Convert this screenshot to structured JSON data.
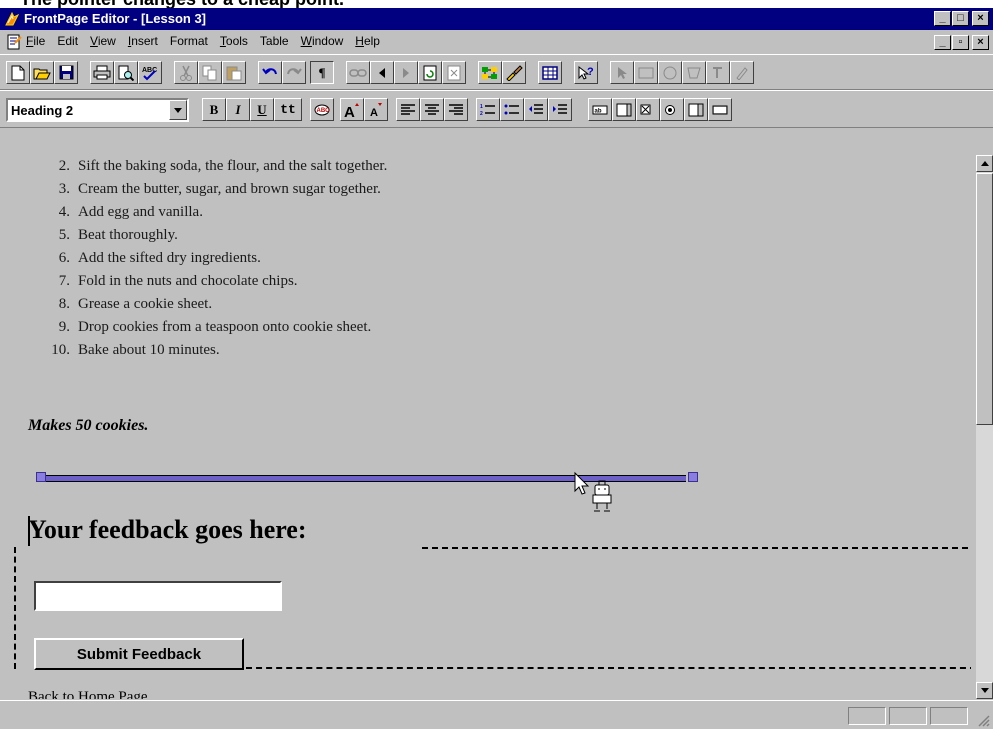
{
  "caption": "The pointer changes to a cheap point.",
  "window": {
    "title": "FrontPage Editor - [Lesson 3]",
    "controls": {
      "minimize": "_",
      "maximize": "□",
      "close": "×",
      "restore": "▫"
    }
  },
  "menu": {
    "items": [
      {
        "first": "F",
        "rest": "ile"
      },
      {
        "first": "",
        "rest": "Edit"
      },
      {
        "first": "V",
        "rest": "iew"
      },
      {
        "first": "I",
        "rest": "nsert"
      },
      {
        "first": "",
        "rest": "Format"
      },
      {
        "first": "T",
        "rest": "ools"
      },
      {
        "first": "",
        "rest": "Table"
      },
      {
        "first": "W",
        "rest": "indow"
      },
      {
        "first": "H",
        "rest": "elp"
      }
    ]
  },
  "format_toolbar": {
    "style_value": "Heading 2",
    "bold": "B",
    "italic": "I",
    "underline": "U",
    "typewriter": "tt"
  },
  "document": {
    "steps": [
      {
        "n": "2.",
        "text": "Sift the baking soda, the flour, and the salt together."
      },
      {
        "n": "3.",
        "text": "Cream the butter, sugar, and brown sugar together."
      },
      {
        "n": "4.",
        "text": "Add egg and vanilla."
      },
      {
        "n": "5.",
        "text": "Beat thoroughly."
      },
      {
        "n": "6.",
        "text": "Add the sifted dry ingredients."
      },
      {
        "n": "7.",
        "text": "Fold in the nuts and chocolate chips."
      },
      {
        "n": "8.",
        "text": "Grease a cookie sheet."
      },
      {
        "n": "9.",
        "text": "Drop cookies from a teaspoon onto cookie sheet."
      },
      {
        "n": "10.",
        "text": "Bake about 10 minutes."
      }
    ],
    "makes": "Makes 50 cookies.",
    "feedback_heading": "Your feedback goes here:",
    "feedback_input_value": "",
    "submit_label": "Submit Feedback",
    "back_link": "Back to Home Page"
  },
  "colors": {
    "titlebar": "#000080",
    "window_face": "#c0c0c0",
    "horizontal_rule": "#6e60c9"
  }
}
